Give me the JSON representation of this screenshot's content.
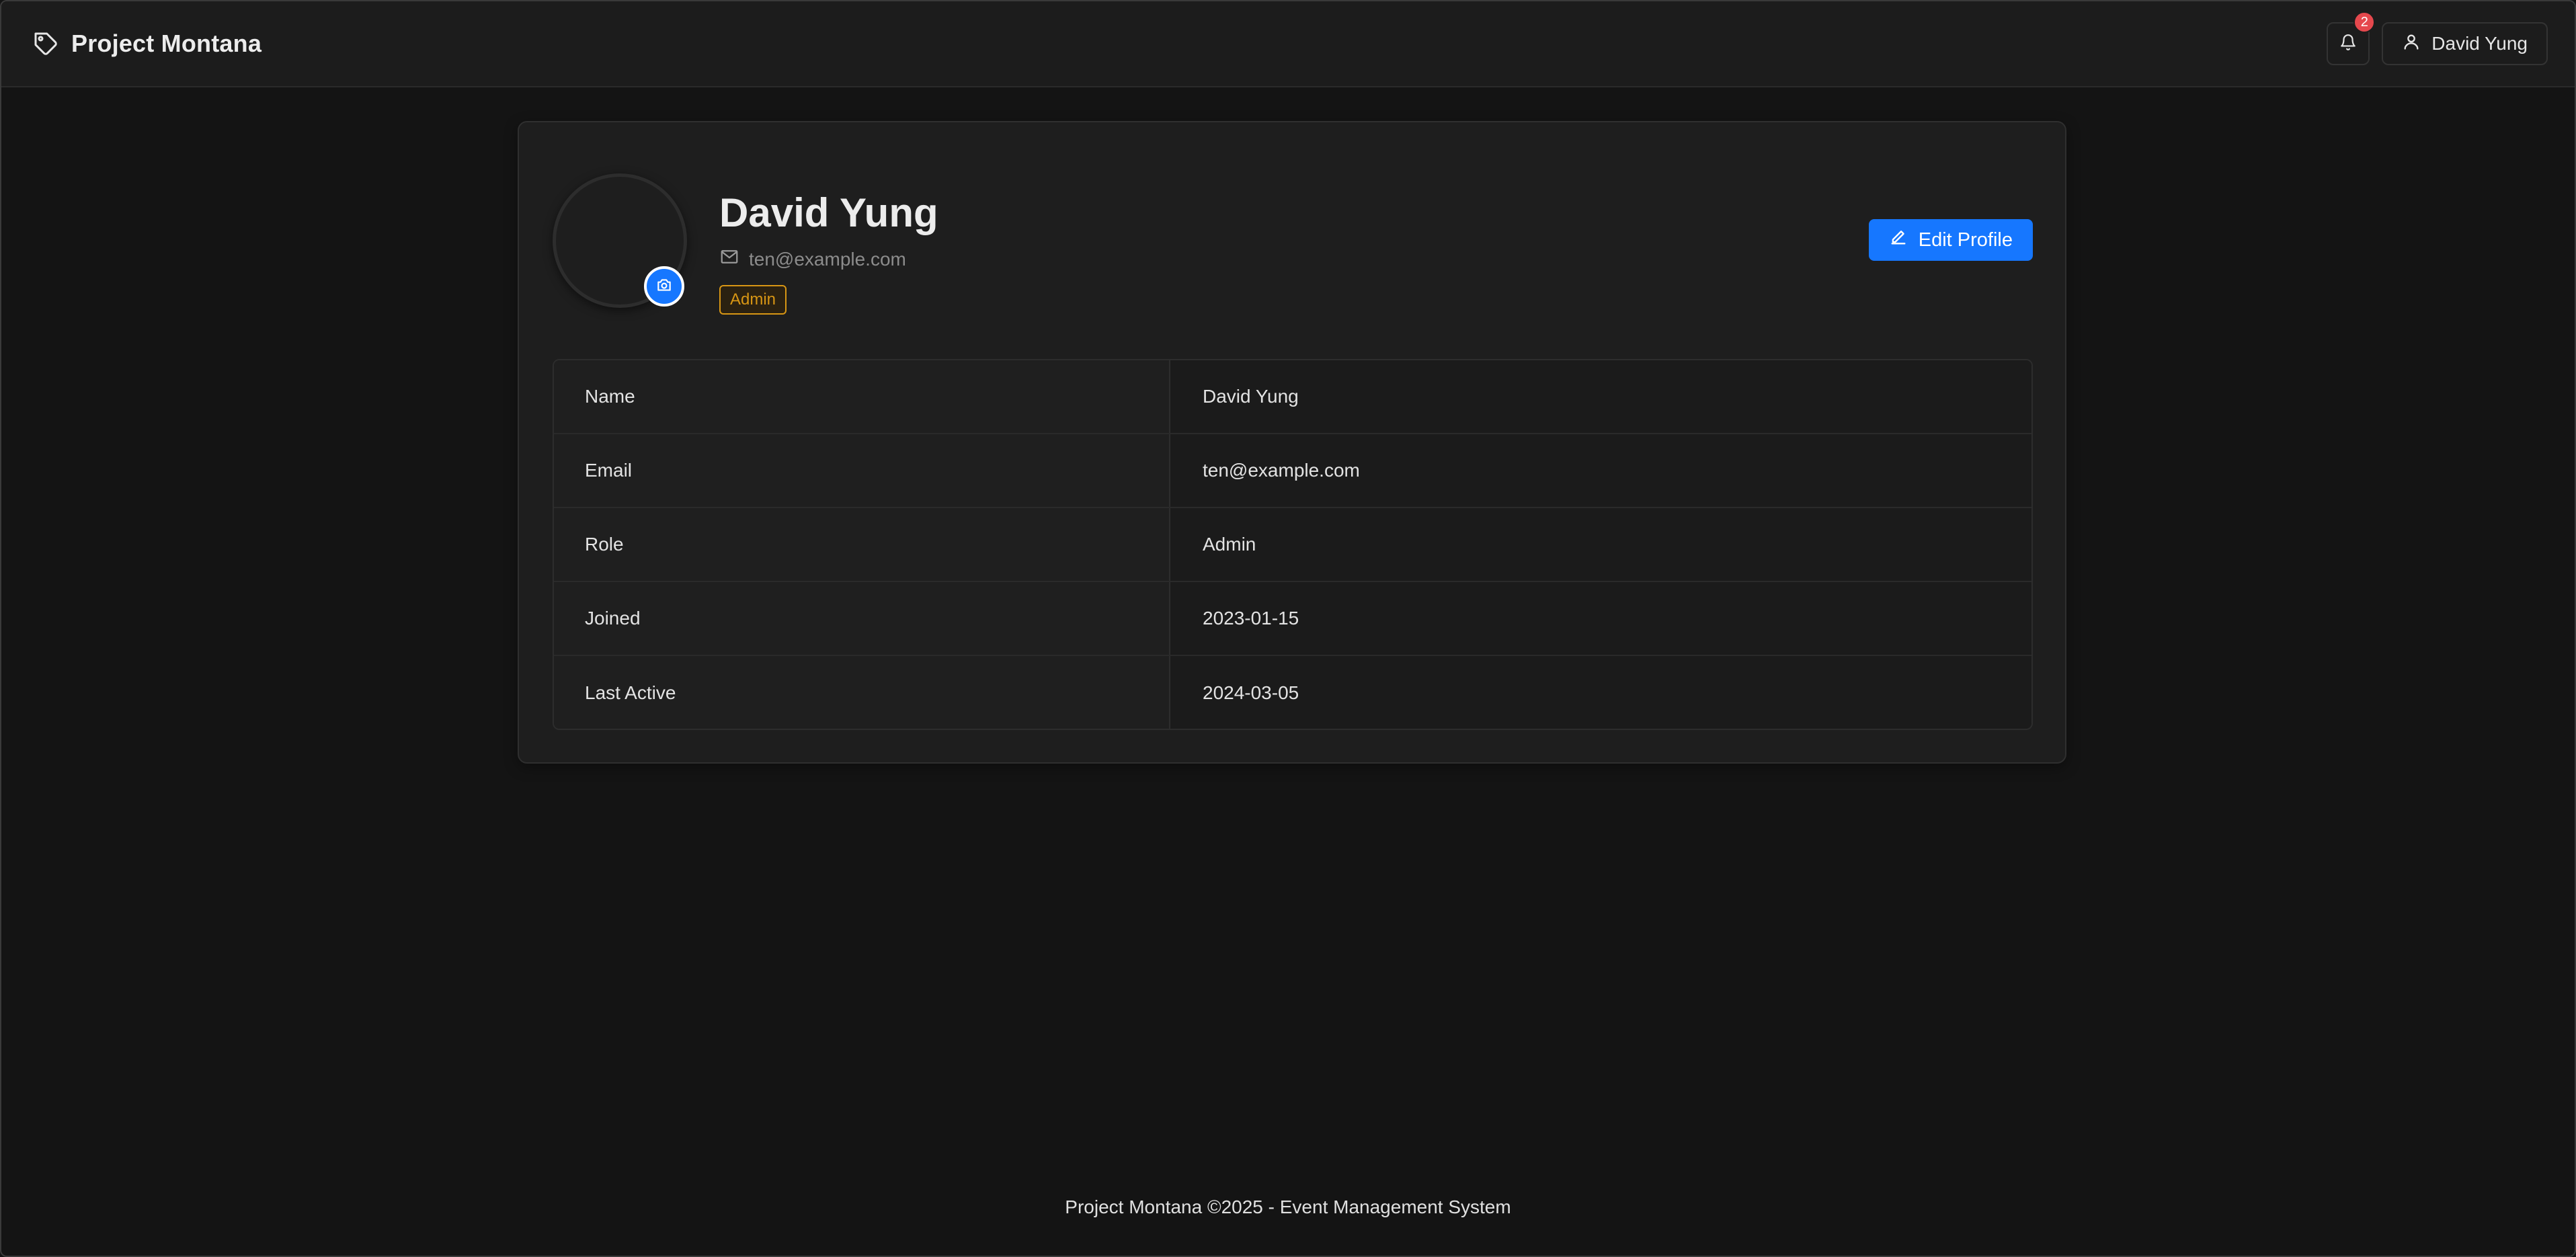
{
  "app": {
    "title": "Project Montana",
    "notification_count": "2",
    "user_name": "David Yung",
    "accent_color": "#1677ff"
  },
  "profile": {
    "name": "David Yung",
    "email": "ten@example.com",
    "role_tag": "Admin",
    "edit_button": "Edit Profile"
  },
  "details": [
    {
      "label": "Name",
      "value": "David Yung"
    },
    {
      "label": "Email",
      "value": "ten@example.com"
    },
    {
      "label": "Role",
      "value": "Admin"
    },
    {
      "label": "Joined",
      "value": "2023-01-15"
    },
    {
      "label": "Last Active",
      "value": "2024-03-05"
    }
  ],
  "footer": {
    "text": "Project Montana ©2025 - Event Management System"
  },
  "icons": [
    "tag-icon",
    "bell-icon",
    "user-icon",
    "camera-icon",
    "mail-icon",
    "edit-icon"
  ]
}
